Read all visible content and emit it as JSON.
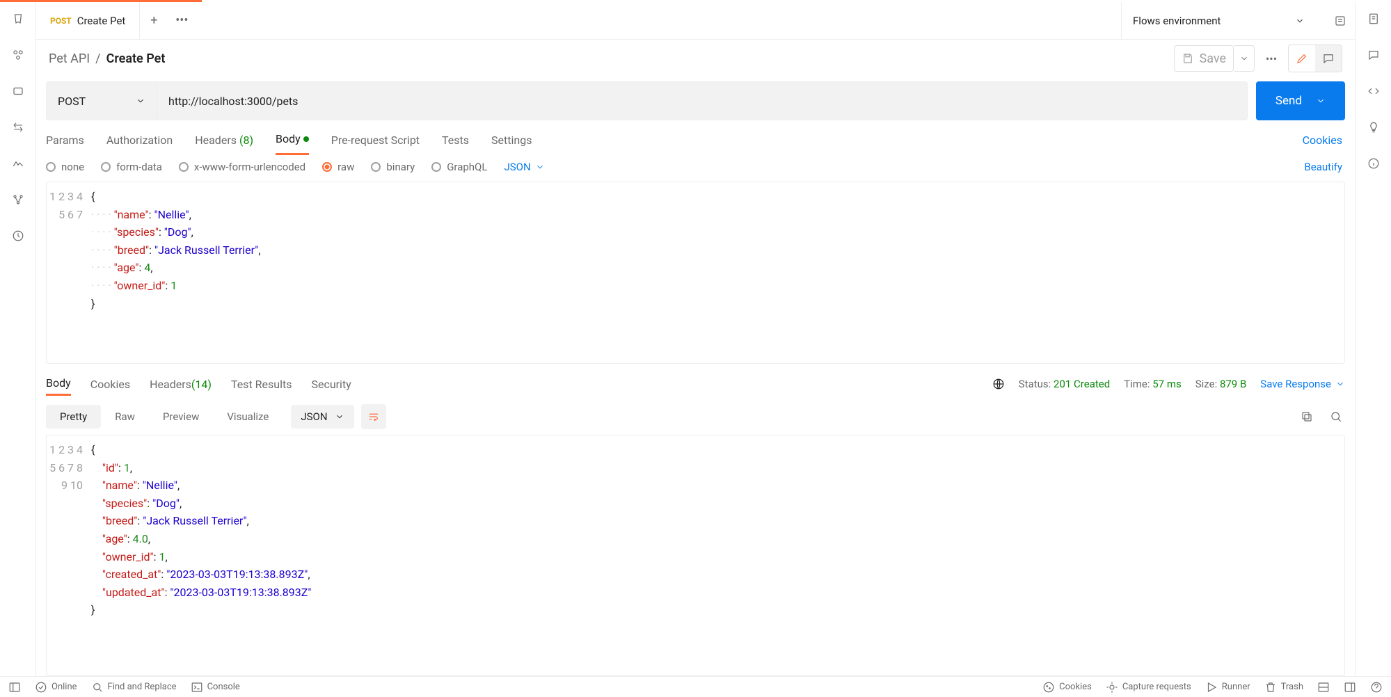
{
  "tab": {
    "method": "POST",
    "title": "Create Pet"
  },
  "environment": "Flows environment",
  "breadcrumb": {
    "parent": "Pet API",
    "current": "Create Pet"
  },
  "save_label": "Save",
  "request": {
    "method": "POST",
    "url": "http://localhost:3000/pets",
    "send": "Send"
  },
  "req_tabs": {
    "params": "Params",
    "auth": "Authorization",
    "headers": "Headers",
    "headers_count": "(8)",
    "body": "Body",
    "prereq": "Pre-request Script",
    "tests": "Tests",
    "settings": "Settings",
    "cookies": "Cookies"
  },
  "body_types": {
    "none": "none",
    "form": "form-data",
    "url": "x-www-form-urlencoded",
    "raw": "raw",
    "binary": "binary",
    "graphql": "GraphQL",
    "lang": "JSON",
    "beautify": "Beautify"
  },
  "req_body_lines": [
    {
      "n": "1",
      "t": "{"
    },
    {
      "n": "2",
      "t": "ind",
      "k": "\"name\"",
      "v": "\"Nellie\"",
      "vt": "s",
      "c": ","
    },
    {
      "n": "3",
      "t": "ind",
      "k": "\"species\"",
      "v": "\"Dog\"",
      "vt": "s",
      "c": ","
    },
    {
      "n": "4",
      "t": "ind",
      "k": "\"breed\"",
      "v": "\"Jack Russell Terrier\"",
      "vt": "s",
      "c": ","
    },
    {
      "n": "5",
      "t": "ind",
      "k": "\"age\"",
      "v": "4",
      "vt": "n",
      "c": ","
    },
    {
      "n": "6",
      "t": "ind",
      "k": "\"owner_id\"",
      "v": "1",
      "vt": "n",
      "c": ""
    },
    {
      "n": "7",
      "t": "}"
    }
  ],
  "resp_tabs": {
    "body": "Body",
    "cookies": "Cookies",
    "headers": "Headers",
    "headers_count": "(14)",
    "tests": "Test Results",
    "security": "Security"
  },
  "resp_meta": {
    "status_l": "Status:",
    "status_v": "201 Created",
    "time_l": "Time:",
    "time_v": "57 ms",
    "size_l": "Size:",
    "size_v": "879 B",
    "save": "Save Response"
  },
  "view_tabs": {
    "pretty": "Pretty",
    "raw": "Raw",
    "preview": "Preview",
    "visualize": "Visualize",
    "fmt": "JSON"
  },
  "resp_body_lines": [
    {
      "n": "1",
      "t": "{"
    },
    {
      "n": "2",
      "k": "\"id\"",
      "v": "1",
      "vt": "n",
      "c": ","
    },
    {
      "n": "3",
      "k": "\"name\"",
      "v": "\"Nellie\"",
      "vt": "s",
      "c": ","
    },
    {
      "n": "4",
      "k": "\"species\"",
      "v": "\"Dog\"",
      "vt": "s",
      "c": ","
    },
    {
      "n": "5",
      "k": "\"breed\"",
      "v": "\"Jack Russell Terrier\"",
      "vt": "s",
      "c": ","
    },
    {
      "n": "6",
      "k": "\"age\"",
      "v": "4.0",
      "vt": "n",
      "c": ","
    },
    {
      "n": "7",
      "k": "\"owner_id\"",
      "v": "1",
      "vt": "n",
      "c": ","
    },
    {
      "n": "8",
      "k": "\"created_at\"",
      "v": "\"2023-03-03T19:13:38.893Z\"",
      "vt": "s",
      "c": ","
    },
    {
      "n": "9",
      "k": "\"updated_at\"",
      "v": "\"2023-03-03T19:13:38.893Z\"",
      "vt": "s",
      "c": ""
    },
    {
      "n": "10",
      "t": "}"
    }
  ],
  "status": {
    "online": "Online",
    "find": "Find and Replace",
    "console": "Console",
    "cookies": "Cookies",
    "capture": "Capture requests",
    "runner": "Runner",
    "trash": "Trash"
  }
}
